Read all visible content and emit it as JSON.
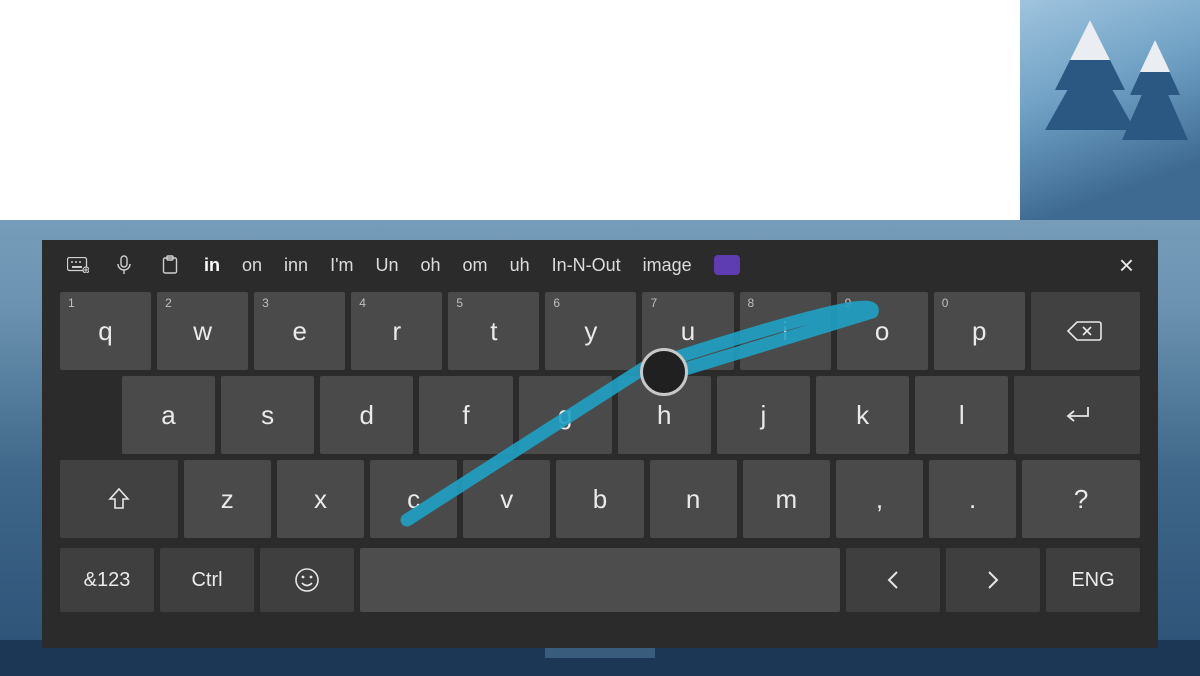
{
  "suggestions": {
    "primary": "in",
    "items": [
      "on",
      "inn",
      "I'm",
      "Un",
      "oh",
      "om",
      "uh",
      "In-N-Out",
      "image"
    ]
  },
  "toolbar": {
    "close_label": "×"
  },
  "keys": {
    "row1": [
      "q",
      "w",
      "e",
      "r",
      "t",
      "y",
      "u",
      "i",
      "o",
      "p"
    ],
    "row1_nums": [
      "1",
      "2",
      "3",
      "4",
      "5",
      "6",
      "7",
      "8",
      "9",
      "0"
    ],
    "row2": [
      "a",
      "s",
      "d",
      "f",
      "g",
      "h",
      "j",
      "k",
      "l"
    ],
    "row3": [
      "z",
      "x",
      "c",
      "v",
      "b",
      "n",
      "m",
      ",",
      ".",
      "?"
    ]
  },
  "bottom": {
    "symbols": "&123",
    "ctrl": "Ctrl",
    "lang": "ENG"
  },
  "colors": {
    "swipe": "#1fa1c4",
    "panel": "#2b2b2b",
    "key": "#4a4a4a"
  }
}
